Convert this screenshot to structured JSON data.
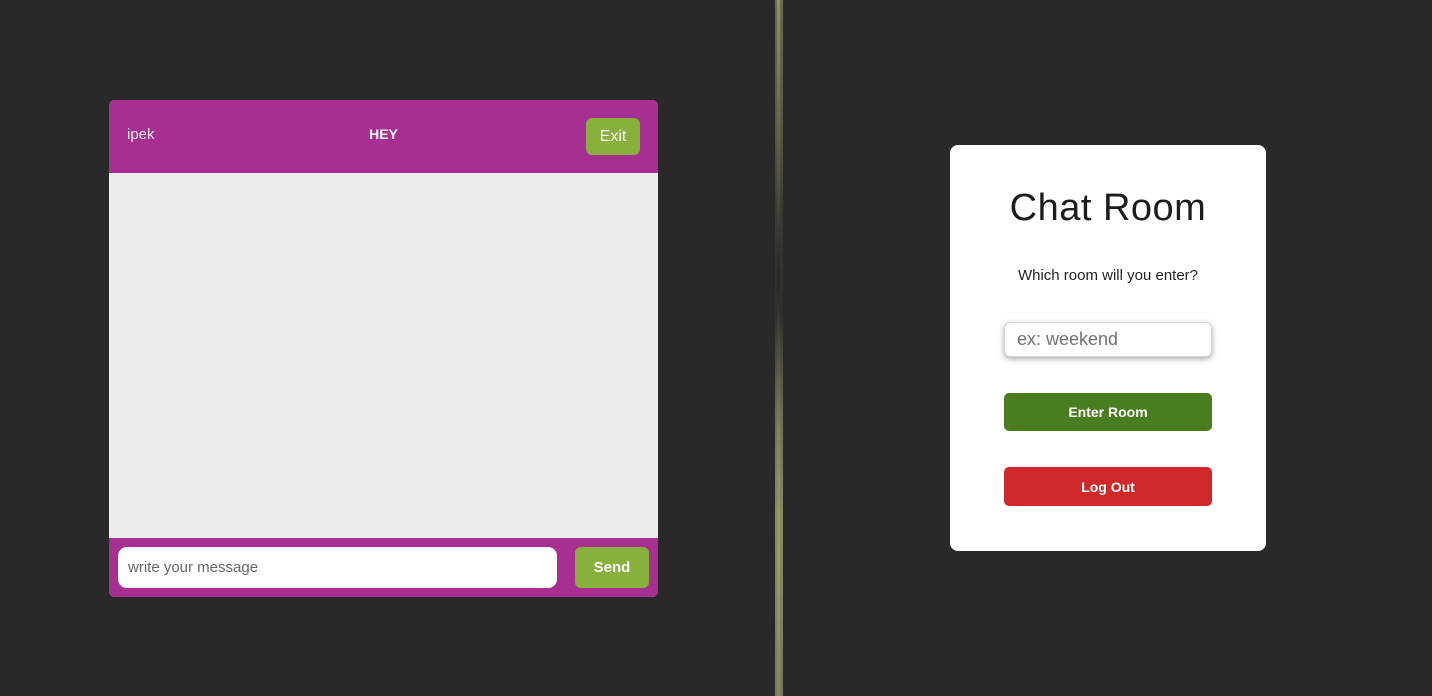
{
  "chat": {
    "username": "ipek",
    "room_name": "HEY",
    "exit_label": "Exit",
    "message_placeholder": "write your message",
    "send_label": "Send"
  },
  "room_select": {
    "title": "Chat Room",
    "question": "Which room will you enter?",
    "room_placeholder": "ex: weekend",
    "enter_label": "Enter Room",
    "logout_label": "Log Out"
  },
  "colors": {
    "background": "#292929",
    "chat_header": "#a82f92",
    "chat_body": "#ececec",
    "exit_send_button": "#87b13c",
    "enter_room_button": "#4a7d1f",
    "logout_button": "#d02828"
  }
}
